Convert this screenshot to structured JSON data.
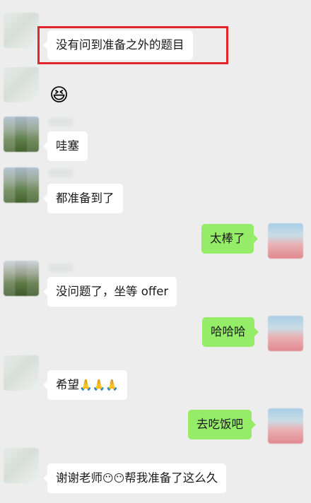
{
  "messages": [
    {
      "side": "left",
      "text": "没有问到准备之外的题目",
      "highlighted": true
    },
    {
      "side": "left",
      "sticker": "😆"
    },
    {
      "side": "left",
      "text": "哇塞"
    },
    {
      "side": "left",
      "text": "都准备到了"
    },
    {
      "side": "right",
      "text": "太棒了"
    },
    {
      "side": "left",
      "text": "没问题了，坐等 offer"
    },
    {
      "side": "right",
      "text": "哈哈哈"
    },
    {
      "side": "left",
      "text": "希望",
      "emoji_suffix": "🙏🙏🙏"
    },
    {
      "side": "right",
      "text": "去吃饭吧"
    },
    {
      "side": "left",
      "text_a": "谢谢老师",
      "emoji_mid": "😶😶",
      "text_b": "帮我准备了这么久"
    }
  ],
  "colors": {
    "background": "#ededed",
    "incoming_bubble": "#ffffff",
    "outgoing_bubble": "#95ec69",
    "highlight_border": "#e0262b"
  },
  "icons": {
    "sticker": "grinning-face-icon",
    "praying-hands": "folded-hands-icon",
    "hushed-face": "hushed-face-icon"
  }
}
